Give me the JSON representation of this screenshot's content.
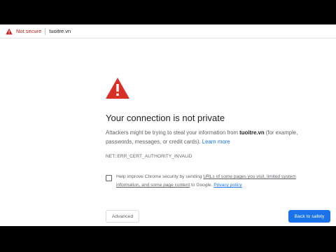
{
  "omnibox": {
    "security_label": "Not secure",
    "url": "tuoitre.vn"
  },
  "interstitial": {
    "icon": "warning-triangle-icon",
    "title": "Your connection is not private",
    "description_before": "Attackers might be trying to steal your information from ",
    "domain": "tuoitre.vn",
    "description_after": " (for example, passwords, messages, or credit cards). ",
    "learn_more": "Learn more",
    "error_code": "NET::ERR_CERT_AUTHORITY_INVALID",
    "improve": {
      "before": "Help improve Chrome security by sending ",
      "link": "URLs of some pages you visit, limited system information, and some page content",
      "middle": " to Google. ",
      "privacy": "Privacy policy"
    },
    "advanced_label": "Advanced",
    "back_label": "Back to safety"
  },
  "colors": {
    "danger": "#c5221f",
    "link": "#1a73e8",
    "primary_button": "#1a73e8",
    "text": "#202124",
    "secondary_text": "#5f6368"
  }
}
